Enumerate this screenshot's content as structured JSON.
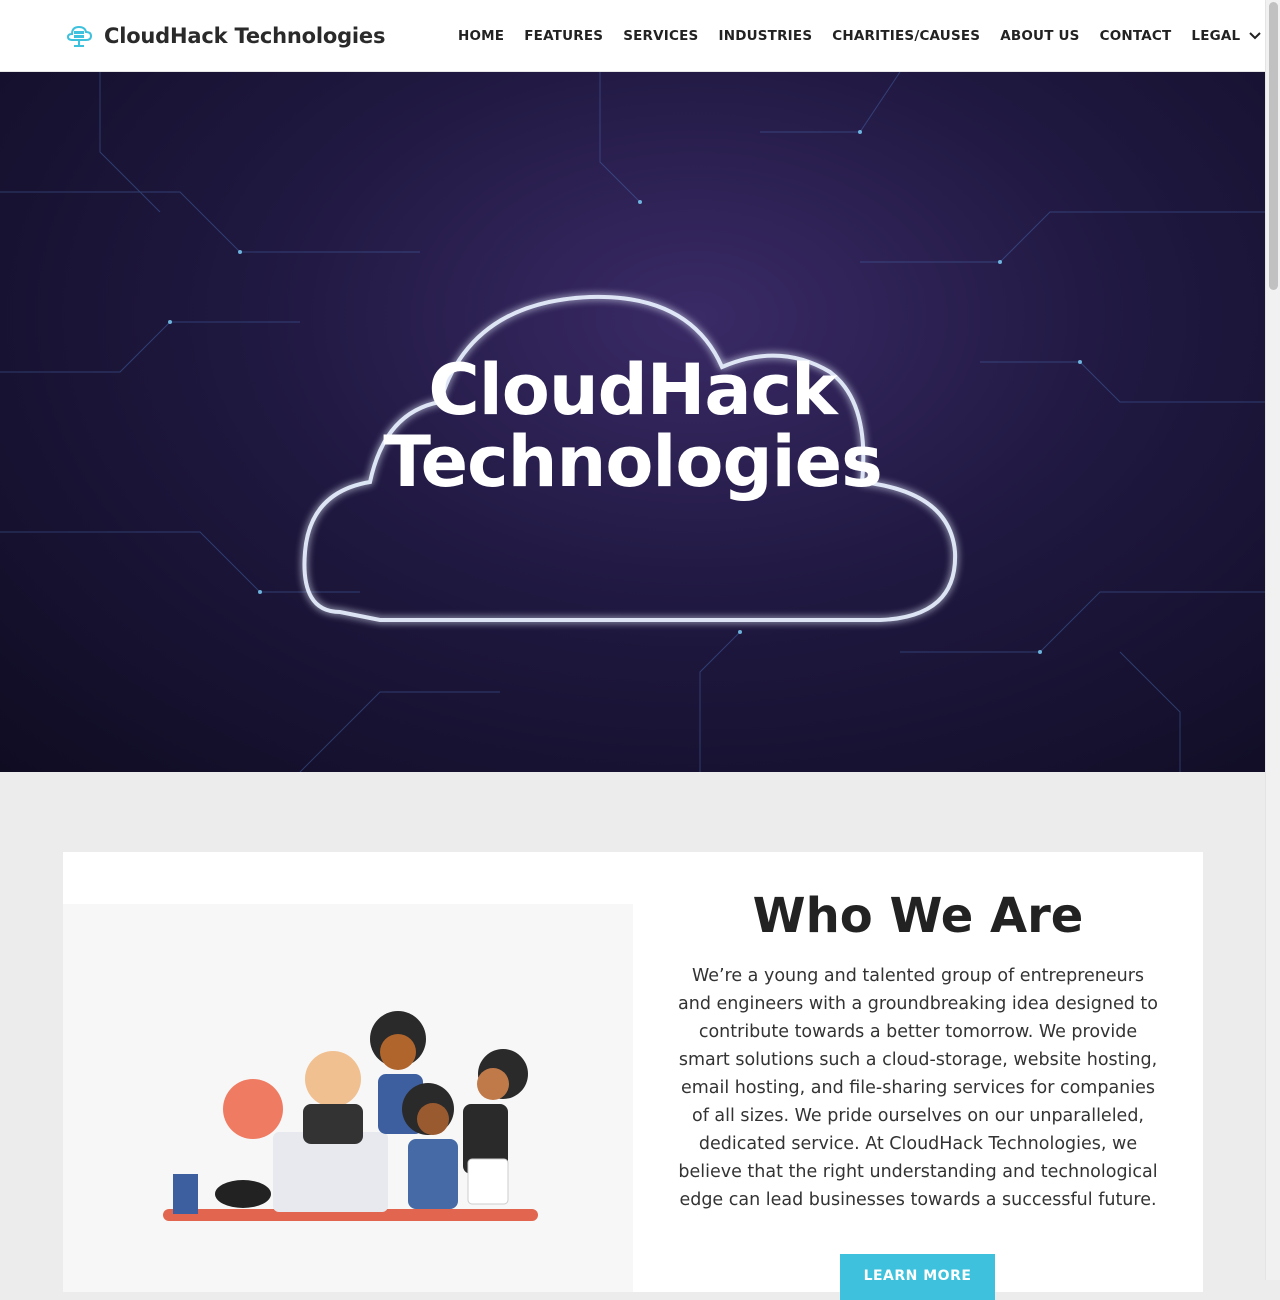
{
  "header": {
    "brand_name": "CloudHack Technologies",
    "brand_icon": "cloud-server-icon",
    "nav": [
      {
        "label": "HOME"
      },
      {
        "label": "FEATURES"
      },
      {
        "label": "SERVICES"
      },
      {
        "label": "INDUSTRIES"
      },
      {
        "label": "CHARITIES/CAUSES"
      },
      {
        "label": "ABOUT US"
      },
      {
        "label": "CONTACT"
      },
      {
        "label": "LEGAL"
      }
    ]
  },
  "hero": {
    "title_line1": "CloudHack",
    "title_line2": "Technologies"
  },
  "about": {
    "title": "Who We Are",
    "body": "We’re a young and talented group of entrepreneurs and engineers with a groundbreaking idea designed to contribute towards a better tomorrow. We provide smart solutions such a cloud-storage, website hosting, email hosting, and file-sharing services for companies of all sizes. We pride ourselves on our unparalleled, dedicated service. At CloudHack Technologies, we believe that the right understanding and technological edge can lead businesses towards a successful future.",
    "button_label": "LEARN MORE"
  },
  "colors": {
    "accent": "#3ec1dc",
    "hero_dark": "#1f1840"
  }
}
